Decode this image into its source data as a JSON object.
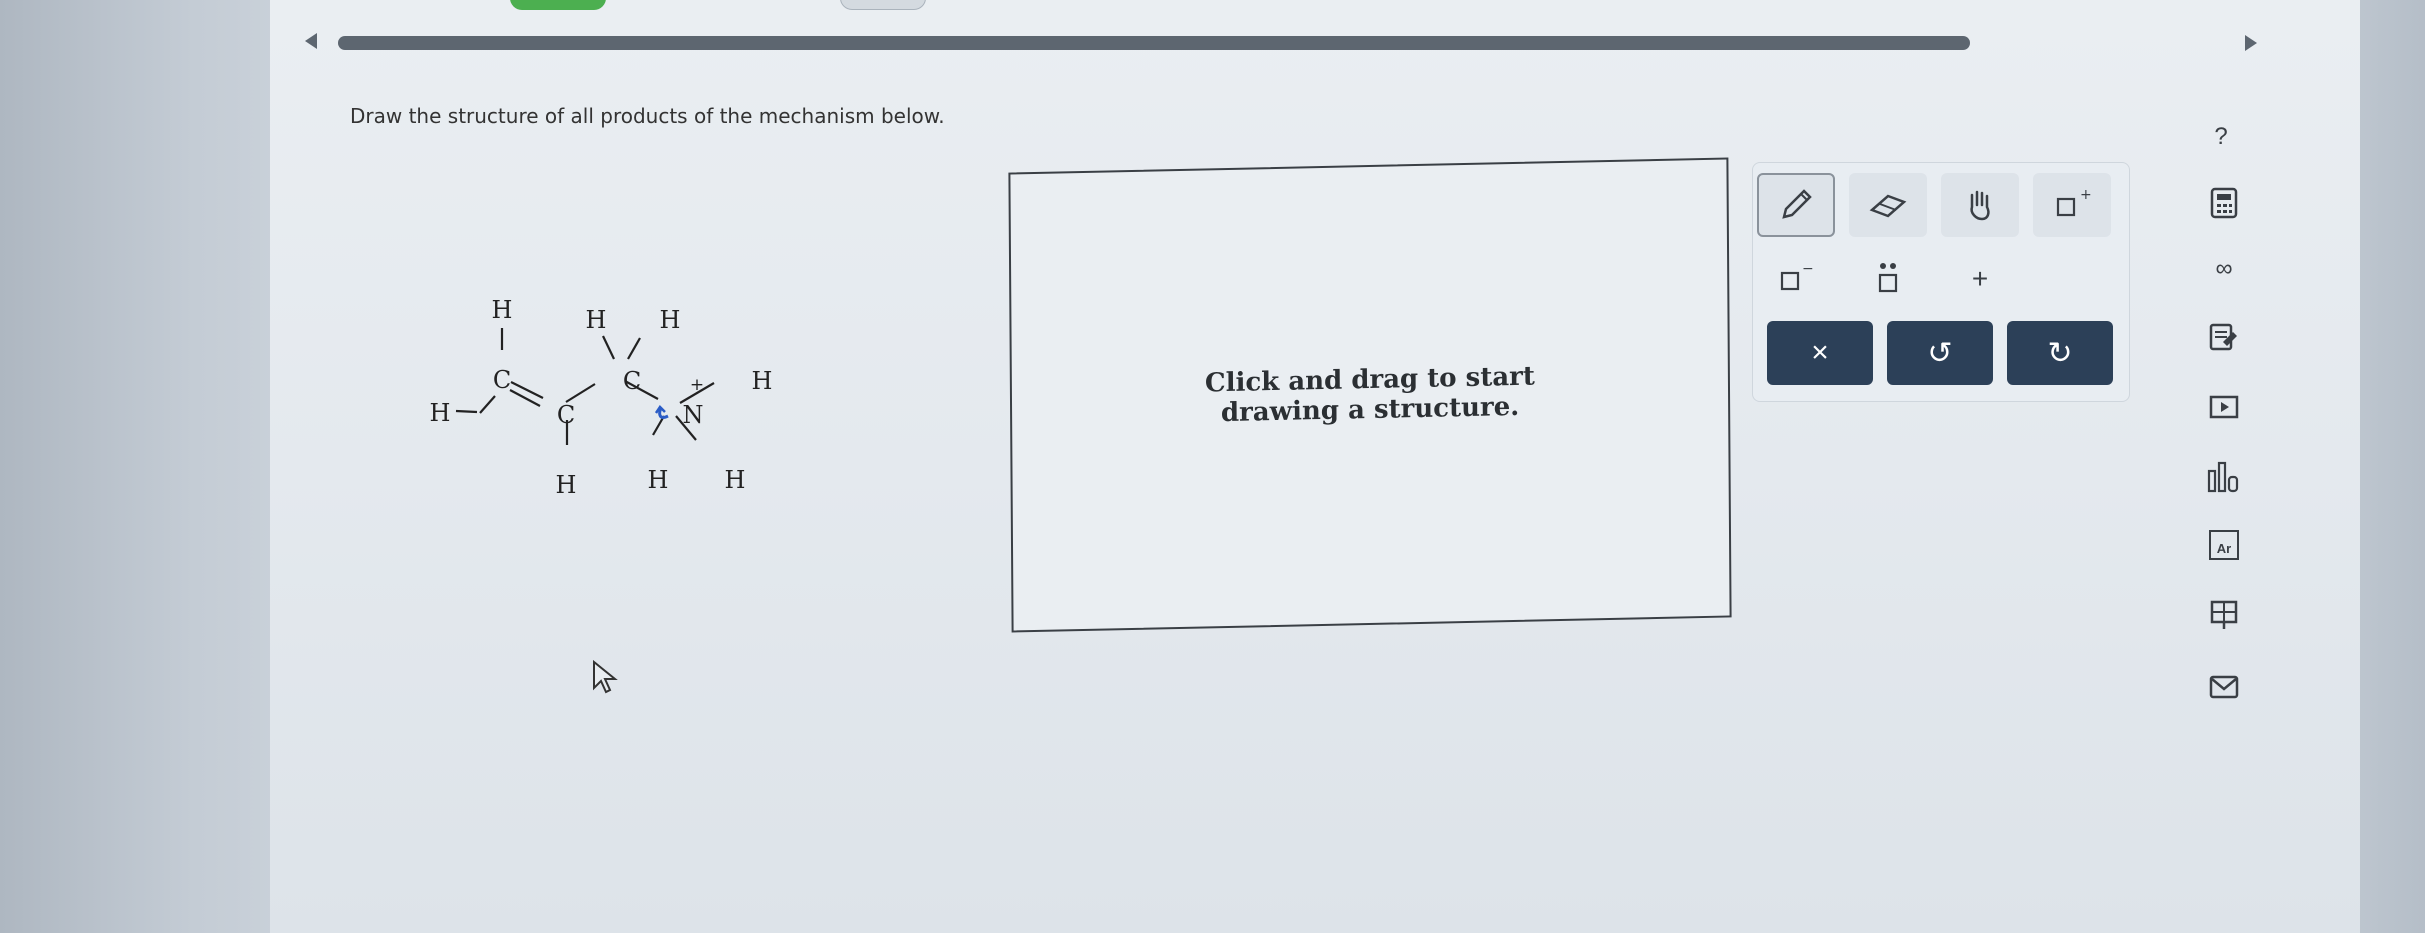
{
  "question": {
    "text": "Draw the structure of all products of the mechanism below."
  },
  "molecule": {
    "atoms": [
      "H",
      "C",
      "H",
      "C",
      "H",
      "H",
      "H",
      "C",
      "N",
      "H",
      "H",
      "H",
      "H"
    ],
    "charge": "+"
  },
  "canvas": {
    "hint_line1": "Click and drag to start",
    "hint_line2": "drawing a structure."
  },
  "toolbar": {
    "tools": [
      {
        "name": "pencil-tool",
        "icon": "pencil-icon",
        "active": true
      },
      {
        "name": "eraser-tool",
        "icon": "eraser-icon"
      },
      {
        "name": "hand-tool",
        "icon": "hand-icon"
      },
      {
        "name": "positive-charge-tool",
        "icon": "positive-charge-icon",
        "label": "+"
      },
      {
        "name": "negative-charge-tool",
        "icon": "negative-charge-icon",
        "label": "−"
      },
      {
        "name": "lone-pair-tool",
        "icon": "lone-pair-icon"
      },
      {
        "name": "add-tool",
        "label": "+"
      }
    ],
    "actions": [
      {
        "name": "clear-button",
        "label": "×"
      },
      {
        "name": "undo-button",
        "label": "↺"
      },
      {
        "name": "redo-button",
        "label": "↻"
      }
    ],
    "accent_color": "#2c4058"
  },
  "sidebar": {
    "help_label": "?",
    "infinity_label": "∞",
    "periodic_label": "Ar"
  }
}
